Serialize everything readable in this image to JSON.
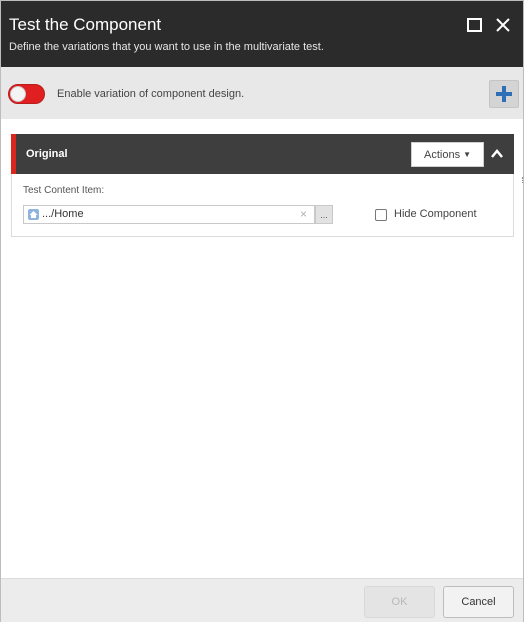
{
  "dialog": {
    "title": "Test the Component",
    "subtitle": "Define the variations that you want to use in the multivariate test."
  },
  "enable_bar": {
    "toggle_state": "off",
    "label": "Enable variation of component design.",
    "add_icon": "plus-icon"
  },
  "variation": {
    "title": "Original",
    "actions_label": "Actions",
    "collapse_icon": "chevron-up-icon",
    "accent_color": "#d9271f",
    "test_content_label": "Test Content Item:",
    "content_value": ".../Home",
    "clear_glyph": "×",
    "browse_label": "...",
    "hide_checked": false,
    "hide_label": "Hide Component"
  },
  "footer": {
    "ok_label": "OK",
    "cancel_label": "Cancel"
  }
}
